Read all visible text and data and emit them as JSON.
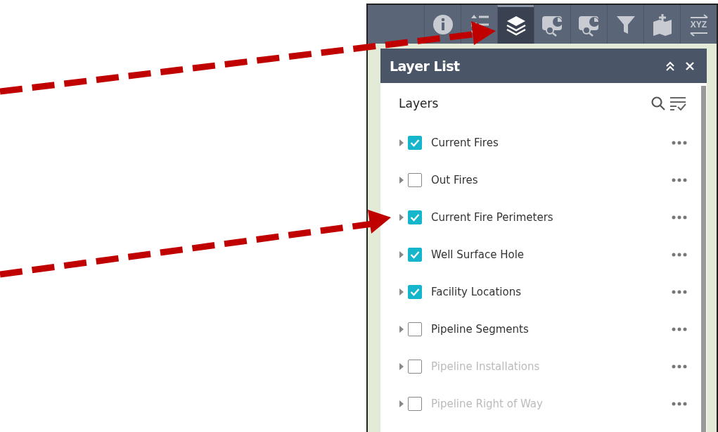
{
  "toolbar": {
    "tools": [
      {
        "kind": "info",
        "selected": false
      },
      {
        "kind": "legend",
        "selected": false
      },
      {
        "kind": "layers",
        "selected": true
      },
      {
        "kind": "chart-search",
        "selected": false
      },
      {
        "kind": "chart-search",
        "selected": false
      },
      {
        "kind": "filter",
        "selected": false
      },
      {
        "kind": "add-data",
        "selected": false
      },
      {
        "kind": "coordinates",
        "selected": false,
        "label": "XYZ"
      }
    ]
  },
  "panel": {
    "title": "Layer List",
    "section_title": "Layers",
    "layers": [
      {
        "name": "Current Fires",
        "checked": true,
        "disabled": false
      },
      {
        "name": "Out Fires",
        "checked": false,
        "disabled": false
      },
      {
        "name": "Current Fire Perimeters",
        "checked": true,
        "disabled": false
      },
      {
        "name": "Well Surface Hole",
        "checked": true,
        "disabled": false
      },
      {
        "name": "Facility Locations",
        "checked": true,
        "disabled": false
      },
      {
        "name": "Pipeline Segments",
        "checked": false,
        "disabled": false
      },
      {
        "name": "Pipeline Installations",
        "checked": false,
        "disabled": true
      },
      {
        "name": "Pipeline Right of Way",
        "checked": false,
        "disabled": true
      }
    ]
  }
}
